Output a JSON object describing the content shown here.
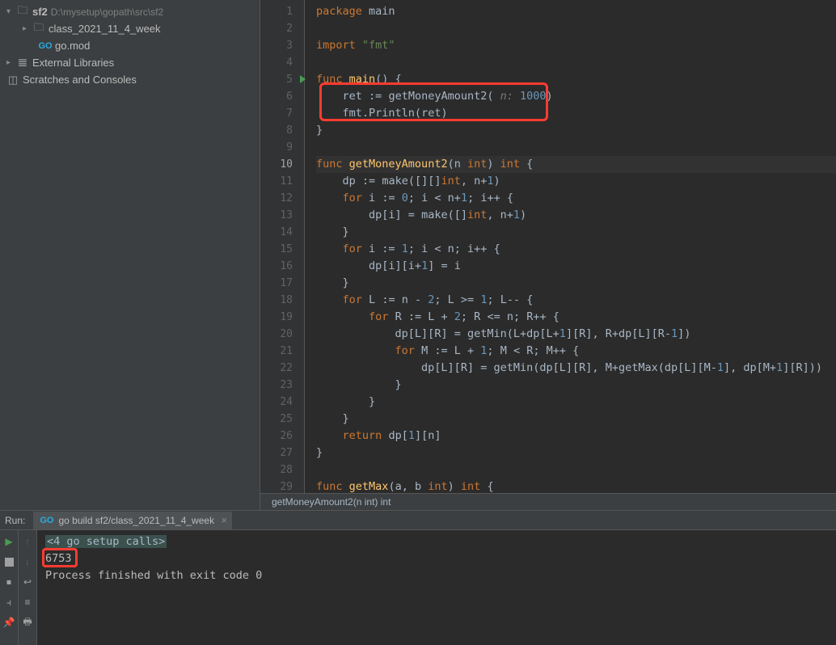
{
  "project": {
    "root": {
      "name": "sf2",
      "path": "D:\\mysetup\\gopath\\src\\sf2"
    },
    "items": [
      {
        "name": "class_2021_11_4_week"
      },
      {
        "name": "go.mod"
      }
    ],
    "libraries": "External Libraries",
    "scratches": "Scratches and Consoles"
  },
  "editor": {
    "lines": [
      {
        "n": "1"
      },
      {
        "n": "2"
      },
      {
        "n": "3"
      },
      {
        "n": "4"
      },
      {
        "n": "5"
      },
      {
        "n": "6"
      },
      {
        "n": "7"
      },
      {
        "n": "8"
      },
      {
        "n": "9"
      },
      {
        "n": "10"
      },
      {
        "n": "11"
      },
      {
        "n": "12"
      },
      {
        "n": "13"
      },
      {
        "n": "14"
      },
      {
        "n": "15"
      },
      {
        "n": "16"
      },
      {
        "n": "17"
      },
      {
        "n": "18"
      },
      {
        "n": "19"
      },
      {
        "n": "20"
      },
      {
        "n": "21"
      },
      {
        "n": "22"
      },
      {
        "n": "23"
      },
      {
        "n": "24"
      },
      {
        "n": "25"
      },
      {
        "n": "26"
      },
      {
        "n": "27"
      },
      {
        "n": "28"
      },
      {
        "n": "29"
      }
    ],
    "code": {
      "package": "package",
      "main": "main",
      "import": "import",
      "fmt": "\"fmt\"",
      "func": "func",
      "fnmain": "main",
      "param0": "()",
      "brace_o": "{",
      "ret": "ret",
      "coloneq": ":=",
      "getMoneyAmount2": "getMoneyAmount2",
      "hint_n": " n: ",
      "num1000": "1000",
      "rparen": ")",
      "fmtPrintln": "fmt.Println",
      "ret2": "ret",
      "n_int": "n ",
      "int_kw": "int",
      "int_ret": " int",
      "dp": "dp",
      "make1": "make([][]",
      "n1": "n+",
      "one": "1",
      "for_kw": "for",
      "i": "i",
      "zero": "0",
      "semi": ";",
      "lt": " < ",
      "pp": "++",
      "dpi": "dp[i]",
      "eq": " = ",
      "make2": "make([]",
      "comma": ", ",
      "i1": "1",
      "ltn": " < n",
      "dpii1": "dp[i][i+",
      "eqi": "] = i",
      "L": "L",
      "nminus": "n - ",
      "two": "2",
      "ge": " >= ",
      "mm": "--",
      "R": "R",
      "Lplus": "L + ",
      "le": " <= n",
      "dpLR": "dp[L][R]",
      "getMin": "getMin",
      "LdpL1R": "L+dp[L+",
      "R_R": "][R]",
      "RdpLR1": "R+dp[L][R-",
      "M": "M",
      "Lp1": "L + ",
      "ltR": " < R",
      "MgetMax": "M+getMax(dp[L][M-",
      "dpM1R": "dp[M+",
      "Rbr": "][R]))",
      "return": "return",
      "dp1n": "dp[",
      "n_br": "][n]",
      "getMax": "getMax",
      "ab": "a",
      "b": "b"
    },
    "breadcrumb": "getMoneyAmount2(n int) int"
  },
  "run": {
    "label": "Run:",
    "tab": "go build sf2/class_2021_11_4_week",
    "setup_calls": "<4 go setup calls>",
    "output": "6753",
    "exit": "Process finished with exit code 0"
  }
}
